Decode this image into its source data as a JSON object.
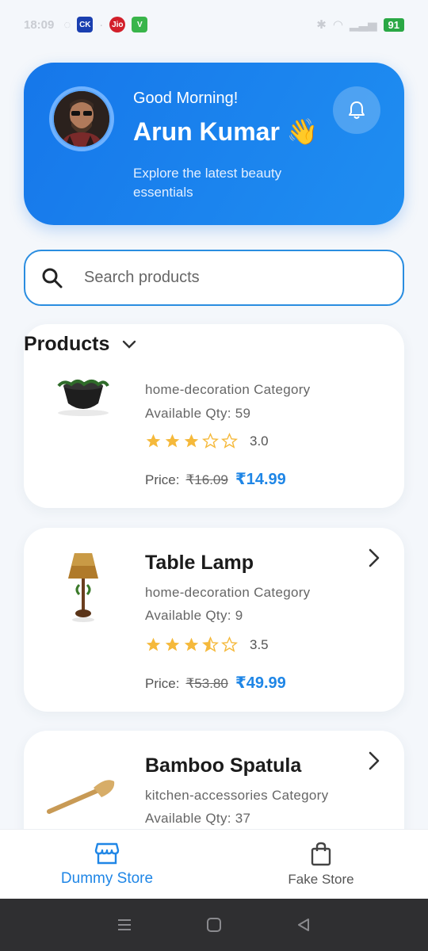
{
  "status_bar": {
    "time": "18:09",
    "badges": [
      "CK",
      "Jio",
      "V"
    ],
    "battery": "91"
  },
  "header": {
    "greeting": "Good Morning!",
    "user_name": "Arun Kumar 👋",
    "tagline": "Explore the latest beauty essentials"
  },
  "search": {
    "placeholder": "Search products"
  },
  "products_section": {
    "title": "Products"
  },
  "products": [
    {
      "name": "",
      "category": "home-decoration Category",
      "qty": "Available Qty: 59",
      "rating": 3.0,
      "rating_text": "3.0",
      "price_label": "Price:",
      "old_price": "₹16.09",
      "new_price": "₹14.99"
    },
    {
      "name": "Table Lamp",
      "category": "home-decoration Category",
      "qty": "Available Qty: 9",
      "rating": 3.5,
      "rating_text": "3.5",
      "price_label": "Price:",
      "old_price": "₹53.80",
      "new_price": "₹49.99"
    },
    {
      "name": "Bamboo Spatula",
      "category": "kitchen-accessories Category",
      "qty": "Available Qty: 37"
    }
  ],
  "bottom_nav": {
    "items": [
      {
        "label": "Dummy Store",
        "icon": "store-icon",
        "active": true
      },
      {
        "label": "Fake Store",
        "icon": "shopping-bag-icon",
        "active": false
      }
    ]
  },
  "colors": {
    "accent": "#1f86e6",
    "header_gradient_start": "#1677ea",
    "star": "#f5b93b"
  }
}
